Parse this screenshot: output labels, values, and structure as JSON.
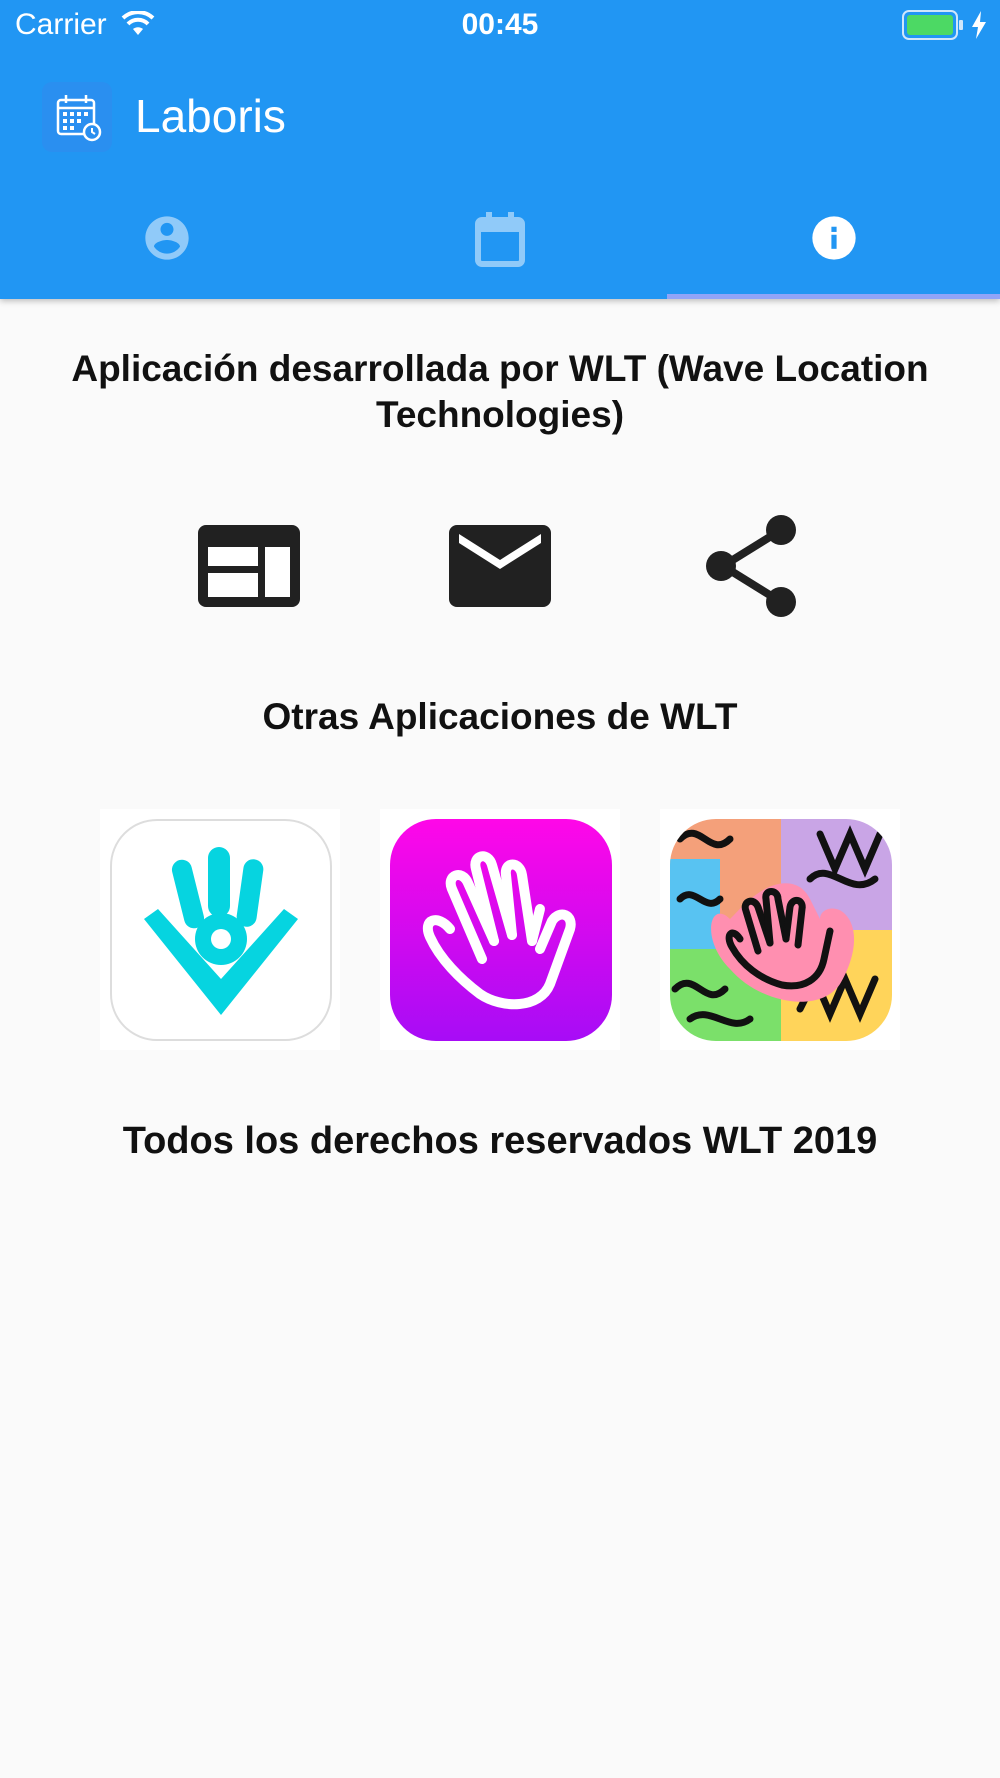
{
  "status_bar": {
    "carrier": "Carrier",
    "time": "00:45"
  },
  "app_bar": {
    "title": "Laboris",
    "logo_icon": "calendar-clock-icon"
  },
  "tabs": [
    {
      "icon": "account-circle-icon",
      "selected": false
    },
    {
      "icon": "calendar-icon",
      "selected": false
    },
    {
      "icon": "info-icon",
      "selected": true
    }
  ],
  "main": {
    "developer_text": "Aplicación desarrollada por WLT (Wave Location Technologies)",
    "actions": [
      {
        "icon": "web-icon"
      },
      {
        "icon": "mail-icon"
      },
      {
        "icon": "share-icon"
      }
    ],
    "other_apps_title": "Otras Aplicaciones de WLT",
    "other_apps": [
      {
        "icon": "cyan-hand-pin-app-icon"
      },
      {
        "icon": "magenta-hand-app-icon"
      },
      {
        "icon": "colorful-hands-app-icon"
      }
    ],
    "rights_text": "Todos los derechos reservados WLT 2019"
  },
  "colors": {
    "primary": "#2196f3",
    "background": "#fafafa",
    "tab_inactive": "#90caf9",
    "tab_active": "#ffffff",
    "text": "#111111"
  }
}
